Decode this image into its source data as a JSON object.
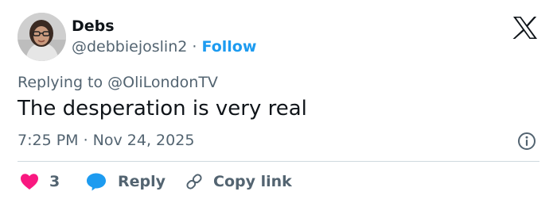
{
  "author": {
    "name": "Debs",
    "handle": "@debbiejoslin2",
    "separator": "·",
    "follow_label": "Follow"
  },
  "reply_context": {
    "prefix": "Replying to",
    "mention": "@OliLondonTV"
  },
  "tweet": {
    "text": "The desperation is very real",
    "timestamp": "7:25 PM · Nov 24, 2025"
  },
  "actions": {
    "like_count": "3",
    "reply_label": "Reply",
    "copy_link_label": "Copy link"
  },
  "icons": {
    "logo": "x-logo-icon",
    "info": "info-icon",
    "like": "heart-icon",
    "reply": "speech-bubble-icon",
    "copy": "link-icon"
  },
  "colors": {
    "text": "#0f1419",
    "secondary": "#536471",
    "accent": "#1d9bf0",
    "like": "#f91880",
    "divider": "#cfd9de"
  }
}
